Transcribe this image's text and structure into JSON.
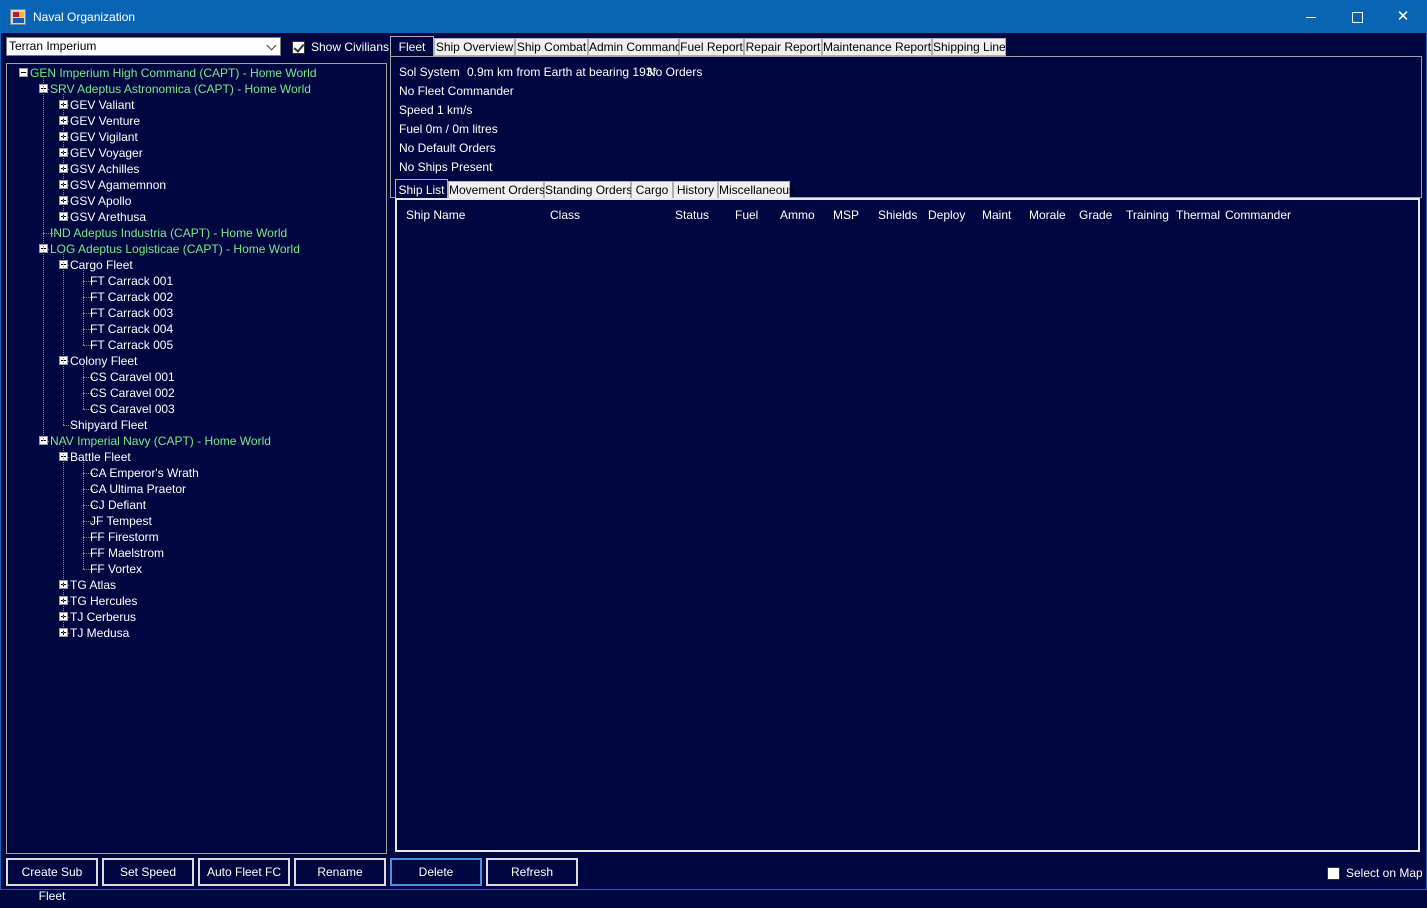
{
  "window": {
    "title": "Naval Organization",
    "minimize_glyph": "",
    "maximize_glyph": "",
    "close_glyph": "✕"
  },
  "race_selector": {
    "value": "Terran Imperium"
  },
  "show_civilians": {
    "label": "Show Civilians",
    "checked": true
  },
  "tree": [
    {
      "label": "GEN Imperium High Command  (CAPT)  -  Home World",
      "color": "green",
      "level": 0,
      "expander": "minus"
    },
    {
      "label": "SRV Adeptus Astronomica  (CAPT)  -  Home World",
      "color": "green",
      "level": 1,
      "expander": "minus"
    },
    {
      "label": "GEV Valiant",
      "color": "white",
      "level": 2,
      "expander": "plus"
    },
    {
      "label": "GEV Venture",
      "color": "white",
      "level": 2,
      "expander": "plus"
    },
    {
      "label": "GEV Vigilant",
      "color": "white",
      "level": 2,
      "expander": "plus"
    },
    {
      "label": "GEV Voyager",
      "color": "white",
      "level": 2,
      "expander": "plus"
    },
    {
      "label": "GSV Achilles",
      "color": "white",
      "level": 2,
      "expander": "plus"
    },
    {
      "label": "GSV Agamemnon",
      "color": "white",
      "level": 2,
      "expander": "plus"
    },
    {
      "label": "GSV Apollo",
      "color": "white",
      "level": 2,
      "expander": "plus"
    },
    {
      "label": "GSV Arethusa",
      "color": "white",
      "level": 2,
      "expander": "plus"
    },
    {
      "label": "IND Adeptus Industria  (CAPT)  -  Home World",
      "color": "green",
      "level": 1,
      "expander": "none"
    },
    {
      "label": "LOG Adeptus Logisticae  (CAPT)  -  Home World",
      "color": "green",
      "level": 1,
      "expander": "minus"
    },
    {
      "label": "Cargo Fleet",
      "color": "white",
      "level": 2,
      "expander": "minus"
    },
    {
      "label": "FT Carrack 001",
      "color": "white",
      "level": 3,
      "expander": "none"
    },
    {
      "label": "FT Carrack 002",
      "color": "white",
      "level": 3,
      "expander": "none"
    },
    {
      "label": "FT Carrack 003",
      "color": "white",
      "level": 3,
      "expander": "none"
    },
    {
      "label": "FT Carrack 004",
      "color": "white",
      "level": 3,
      "expander": "none"
    },
    {
      "label": "FT Carrack 005",
      "color": "white",
      "level": 3,
      "expander": "none"
    },
    {
      "label": "Colony Fleet",
      "color": "white",
      "level": 2,
      "expander": "minus"
    },
    {
      "label": "CS Caravel 001",
      "color": "white",
      "level": 3,
      "expander": "none"
    },
    {
      "label": "CS Caravel 002",
      "color": "white",
      "level": 3,
      "expander": "none"
    },
    {
      "label": "CS Caravel 003",
      "color": "white",
      "level": 3,
      "expander": "none"
    },
    {
      "label": "Shipyard Fleet",
      "color": "white",
      "level": 2,
      "expander": "none"
    },
    {
      "label": "NAV Imperial Navy  (CAPT)  -  Home World",
      "color": "green",
      "level": 1,
      "expander": "minus"
    },
    {
      "label": "Battle Fleet",
      "color": "white",
      "level": 2,
      "expander": "minus"
    },
    {
      "label": "CA Emperor's Wrath",
      "color": "white",
      "level": 3,
      "expander": "none"
    },
    {
      "label": "CA Ultima Praetor",
      "color": "white",
      "level": 3,
      "expander": "none"
    },
    {
      "label": "CJ Defiant",
      "color": "white",
      "level": 3,
      "expander": "none"
    },
    {
      "label": "JF Tempest",
      "color": "white",
      "level": 3,
      "expander": "none"
    },
    {
      "label": "FF Firestorm",
      "color": "white",
      "level": 3,
      "expander": "none"
    },
    {
      "label": "FF Maelstrom",
      "color": "white",
      "level": 3,
      "expander": "none"
    },
    {
      "label": "FF Vortex",
      "color": "white",
      "level": 3,
      "expander": "none"
    },
    {
      "label": "TG Atlas",
      "color": "white",
      "level": 2,
      "expander": "plus"
    },
    {
      "label": "TG Hercules",
      "color": "white",
      "level": 2,
      "expander": "plus"
    },
    {
      "label": "TJ Cerberus",
      "color": "white",
      "level": 2,
      "expander": "plus"
    },
    {
      "label": "TJ Medusa",
      "color": "white",
      "level": 2,
      "expander": "plus"
    }
  ],
  "main_tabs": [
    "Fleet",
    "Ship Overview",
    "Ship Combat",
    "Admin Command",
    "Fuel Report",
    "Repair Report",
    "Maintenance Report",
    "Shipping Line"
  ],
  "main_tab_active": "Fleet",
  "fleet_info": {
    "system": "Sol System",
    "location": "0.9m km from Earth at bearing 193°",
    "orders": "No Orders",
    "commander": "No Fleet Commander",
    "speed": "Speed 1 km/s",
    "fuel": "Fuel 0m / 0m litres",
    "default_orders": "No Default Orders",
    "ships_present": "No Ships Present"
  },
  "sub_tabs": [
    "Ship List",
    "Movement Orders",
    "Standing Orders",
    "Cargo",
    "History",
    "Miscellaneous"
  ],
  "sub_tab_active": "Ship List",
  "ship_list_columns": [
    "Ship Name",
    "Class",
    "Status",
    "Fuel",
    "Ammo",
    "MSP",
    "Shields",
    "Deploy",
    "Maint",
    "Morale",
    "Grade",
    "Training",
    "Thermal",
    "Commander"
  ],
  "buttons": {
    "create_sub_fleet": "Create Sub Fleet",
    "set_speed": "Set Speed",
    "auto_fleet_fc": "Auto Fleet FC",
    "rename": "Rename",
    "delete": "Delete",
    "refresh": "Refresh"
  },
  "select_on_map": {
    "label": "Select on Map",
    "checked": false
  },
  "colors": {
    "background": "#000640",
    "titlebar": "#0a64b4",
    "tree_green": "#78e88a",
    "text": "#ffffff"
  }
}
